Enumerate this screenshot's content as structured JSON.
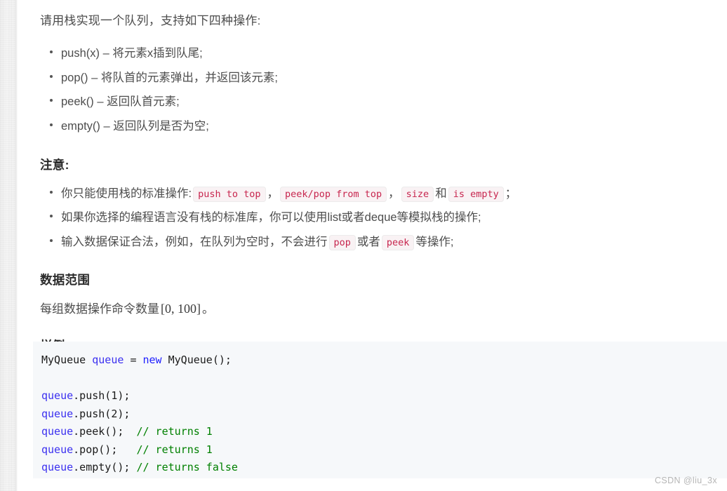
{
  "article": {
    "lead": "请用栈实现一个队列，支持如下四种操作:",
    "operations": [
      "push(x) – 将元素x插到队尾;",
      "pop() – 将队首的元素弹出，并返回该元素;",
      "peek() – 返回队首元素;",
      "empty() – 返回队列是否为空;"
    ],
    "notes_heading": "注意:",
    "notes": {
      "line1_prefix": "你只能使用栈的标准操作:",
      "line1_code1": "push to top",
      "line1_sep1": "，",
      "line1_code2": "peek/pop from top",
      "line1_sep2": "，",
      "line1_code3": "size",
      "line1_and": "和",
      "line1_code4": "is empty",
      "line1_suffix": "；",
      "line2": "如果你选择的编程语言没有栈的标准库，你可以使用list或者deque等模拟栈的操作;",
      "line3_prefix": "输入数据保证合法，例如，在队列为空时，不会进行",
      "line3_code1": "pop",
      "line3_mid": "或者",
      "line3_code2": "peek",
      "line3_suffix": "等操作;"
    },
    "range_heading": "数据范围",
    "range_prefix": "每组数据操作命令数量",
    "range_math": "[0, 100]",
    "range_suffix": "。",
    "example_heading": "样例"
  },
  "code_block": {
    "line1_type": "MyQueue",
    "line1_var": "queue",
    "line1_eq": "=",
    "line1_kw": "new",
    "line1_ctor": "MyQueue();",
    "line2_var": "queue",
    "line2_call": ".push(1);",
    "line3_var": "queue",
    "line3_call": ".push(2);",
    "line4_var": "queue",
    "line4_call": ".peek();",
    "line4_comment": "// returns 1",
    "line5_var": "queue",
    "line5_call": ".pop();",
    "line5_comment": "// returns 1",
    "line6_var": "queue",
    "line6_call": ".empty();",
    "line6_comment": "// returns false"
  },
  "watermark": {
    "text": "CSDN @liu_3x"
  },
  "colors": {
    "body_text": "#4d4d4d",
    "heading": "#2b2b2b",
    "inline_code_text": "#c7254e",
    "inline_code_bg": "#f9f2f4",
    "code_block_bg": "#f6f8fa",
    "code_variable": "#3b30f0",
    "code_keyword": "#1d1dff",
    "code_comment": "#008000",
    "watermark": "#b6b6b6"
  }
}
